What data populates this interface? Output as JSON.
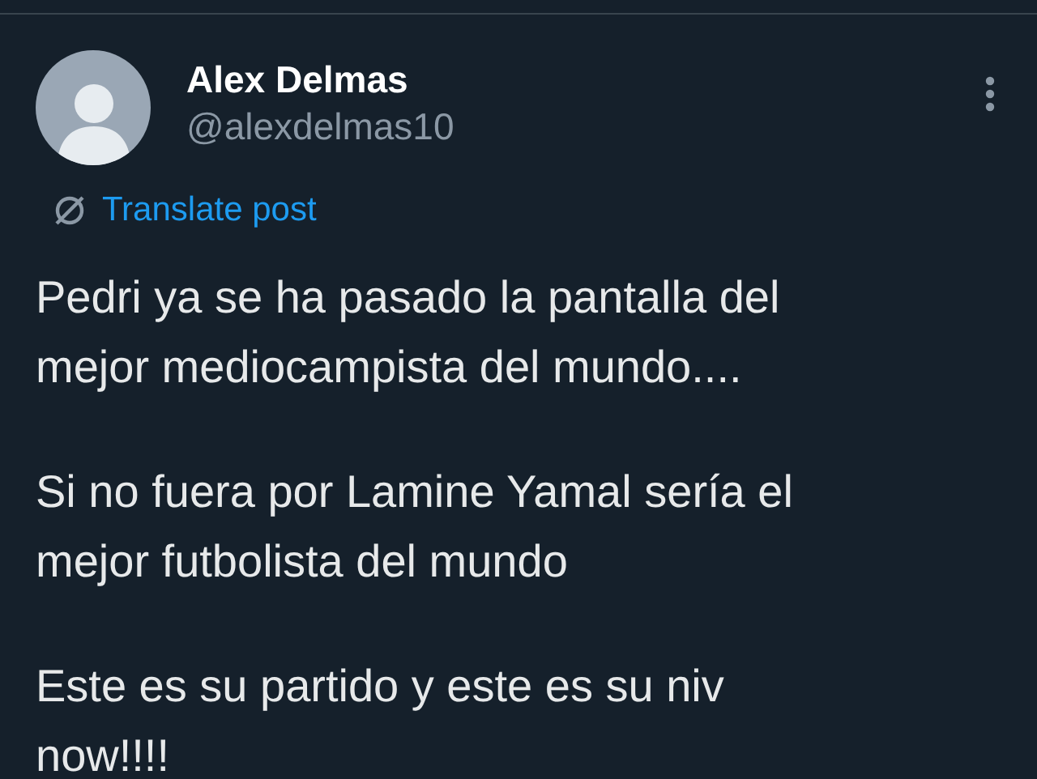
{
  "post": {
    "author_name": "Alex Delmas",
    "handle": "@alexdelmas10",
    "translate_label": "Translate post",
    "paragraphs": [
      {
        "lines": [
          "Pedri ya se ha pasado la pantalla del",
          "mejor mediocampista del mundo...."
        ]
      },
      {
        "lines": [
          "Si no fuera por Lamine Yamal sería el",
          "mejor futbolista del mundo"
        ]
      },
      {
        "lines": [
          "Este es su partido y este es su niv",
          "now!!!!"
        ]
      }
    ]
  }
}
